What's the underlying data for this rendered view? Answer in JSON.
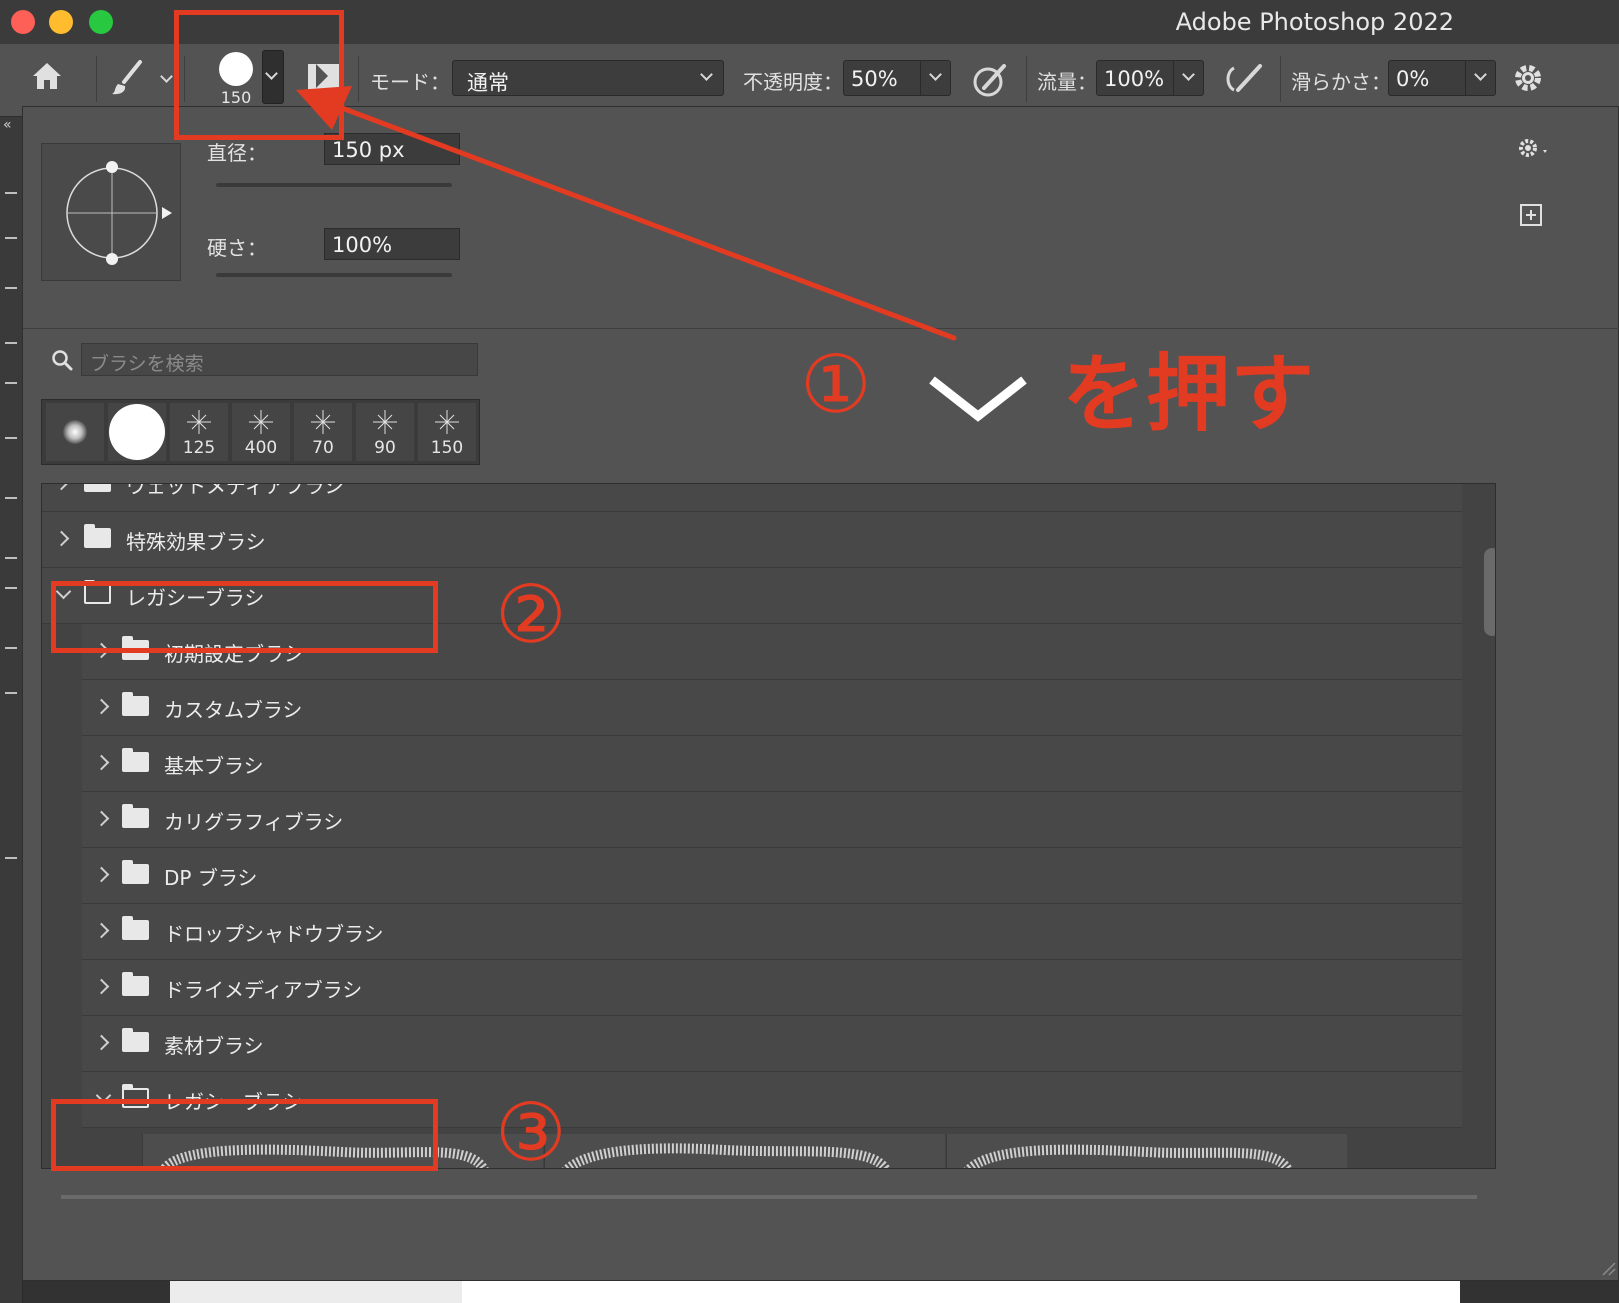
{
  "window": {
    "title": "Adobe Photoshop 2022"
  },
  "options_bar": {
    "brush_size": "150",
    "mode_label": "モード：",
    "mode_value": "通常",
    "opacity_label": "不透明度：",
    "opacity_value": "50%",
    "flow_label": "流量：",
    "flow_value": "100%",
    "smoothing_label": "滑らかさ：",
    "smoothing_value": "0%"
  },
  "brush_panel": {
    "diameter_label": "直径：",
    "diameter_value": "150 px",
    "hardness_label": "硬さ：",
    "hardness_value": "100%",
    "diameter_level": 0.71,
    "hardness_level": 1.0,
    "search_placeholder": "ブラシを検索",
    "presets": [
      {
        "icon": "soft-round-brush",
        "size": ""
      },
      {
        "icon": "hard-round-brush",
        "size": ""
      },
      {
        "icon": "star-brush",
        "size": "125"
      },
      {
        "icon": "star-brush",
        "size": "400"
      },
      {
        "icon": "star-brush",
        "size": "70"
      },
      {
        "icon": "star-brush",
        "size": "90"
      },
      {
        "icon": "star-brush",
        "size": "150"
      }
    ],
    "folders": [
      {
        "label": "ウェットメディアブラシ",
        "level": 0,
        "expanded": false
      },
      {
        "label": "特殊効果ブラシ",
        "level": 0,
        "expanded": false
      },
      {
        "label": "レガシーブラシ",
        "level": 0,
        "expanded": true
      },
      {
        "label": "初期設定ブラシ",
        "level": 1,
        "expanded": false
      },
      {
        "label": "カスタムブラシ",
        "level": 1,
        "expanded": false
      },
      {
        "label": "基本ブラシ",
        "level": 1,
        "expanded": false
      },
      {
        "label": "カリグラフィブラシ",
        "level": 1,
        "expanded": false
      },
      {
        "label": "DP ブラシ",
        "level": 1,
        "expanded": false
      },
      {
        "label": "ドロップシャドウブラシ",
        "level": 1,
        "expanded": false
      },
      {
        "label": "ドライメディアブラシ",
        "level": 1,
        "expanded": false
      },
      {
        "label": "素材ブラシ",
        "level": 1,
        "expanded": false
      },
      {
        "label": "レガシーブラシ",
        "level": 1,
        "expanded": true
      }
    ],
    "preview_size_level": 0.33
  },
  "annotations": {
    "step1_num": "①",
    "step1_text": "を押す",
    "step2_num": "②",
    "step3_num": "③",
    "color": "#e23b22"
  }
}
